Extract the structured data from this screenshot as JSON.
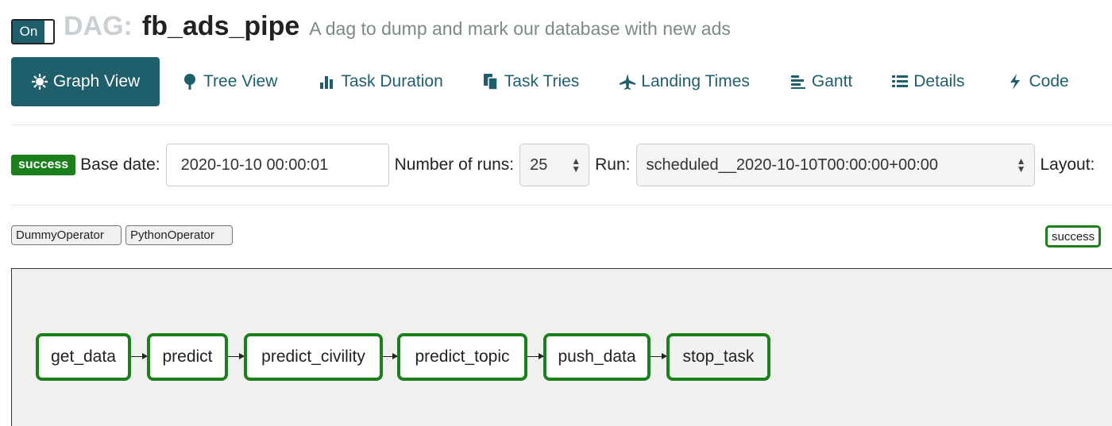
{
  "header": {
    "toggle_label": "On",
    "dag_label": "DAG:",
    "dag_id": "fb_ads_pipe",
    "description": "A dag to dump and mark our database with new ads"
  },
  "nav": {
    "items": [
      {
        "label": "Graph View",
        "icon": "sun-icon",
        "active": true
      },
      {
        "label": "Tree View",
        "icon": "tree-icon"
      },
      {
        "label": "Task Duration",
        "icon": "bar-chart-icon"
      },
      {
        "label": "Task Tries",
        "icon": "files-icon"
      },
      {
        "label": "Landing Times",
        "icon": "plane-icon"
      },
      {
        "label": "Gantt",
        "icon": "gantt-icon"
      },
      {
        "label": "Details",
        "icon": "list-icon"
      },
      {
        "label": "Code",
        "icon": "bolt-icon"
      }
    ]
  },
  "controls": {
    "status_badge": "success",
    "base_date_label": "Base date:",
    "base_date_value": "2020-10-10 00:00:01",
    "num_runs_label": "Number of runs:",
    "num_runs_value": "25",
    "run_label": "Run:",
    "run_value": "scheduled__2020-10-10T00:00:00+00:00",
    "layout_label": "Layout:"
  },
  "legend": {
    "operators": [
      "DummyOperator",
      "PythonOperator"
    ],
    "states": [
      "success"
    ]
  },
  "graph": {
    "nodes": [
      "get_data",
      "predict",
      "predict_civility",
      "predict_topic",
      "push_data",
      "stop_task"
    ]
  },
  "colors": {
    "primary": "#1f5f6b",
    "success": "#1b7f1b",
    "graph_bg": "#f0f0ef"
  }
}
